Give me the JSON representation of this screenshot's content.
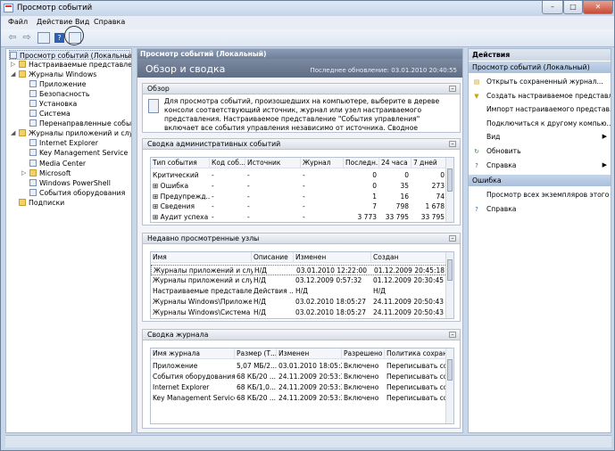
{
  "window": {
    "title": "Просмотр событий",
    "minimize": "–",
    "maximize": "□",
    "close": "✕"
  },
  "menu": [
    "Файл",
    "Действие",
    "Вид",
    "Справка"
  ],
  "toolbar": {
    "back": "⇦",
    "forward": "⇨"
  },
  "tree": {
    "root": "Просмотр событий (Локальный)",
    "items": [
      {
        "label": "Настраиваемые представлен",
        "indent": 1,
        "expander": "▷",
        "icon": "folder"
      },
      {
        "label": "Журналы Windows",
        "indent": 1,
        "expander": "◢",
        "icon": "folder"
      },
      {
        "label": "Приложение",
        "indent": 2,
        "icon": "log"
      },
      {
        "label": "Безопасность",
        "indent": 2,
        "icon": "log"
      },
      {
        "label": "Установка",
        "indent": 2,
        "icon": "log"
      },
      {
        "label": "Система",
        "indent": 2,
        "icon": "log"
      },
      {
        "label": "Перенаправленные события",
        "indent": 2,
        "icon": "log"
      },
      {
        "label": "Журналы приложений и служб",
        "indent": 1,
        "expander": "◢",
        "icon": "folder"
      },
      {
        "label": "Internet Explorer",
        "indent": 2,
        "icon": "log"
      },
      {
        "label": "Key Management Service",
        "indent": 2,
        "icon": "log"
      },
      {
        "label": "Media Center",
        "indent": 2,
        "icon": "log"
      },
      {
        "label": "Microsoft",
        "indent": 2,
        "expander": "▷",
        "icon": "folder"
      },
      {
        "label": "Windows PowerShell",
        "indent": 2,
        "icon": "log"
      },
      {
        "label": "События оборудования",
        "indent": 2,
        "icon": "log"
      },
      {
        "label": "Подписки",
        "indent": 1,
        "icon": "folder"
      }
    ]
  },
  "center": {
    "header": "Просмотр событий (Локальный)",
    "title": "Обзор и сводка",
    "updated": "Последнее обновление: 03.01.2010 20:40:55",
    "overview": {
      "title": "Обзор",
      "text": "Для просмотра событий, произошедших на компьютере, выберите в дереве консоли соответствующий источник, журнал или узел настраиваемого представления. Настраиваемое представление \"События управления\" включает все события управления независимо от источника. Сводное представление всех журналов"
    },
    "admin": {
      "title": "Сводка административных событий",
      "columns": [
        "Тип события",
        "Код соб...",
        "Источник",
        "Журнал",
        "Последн...",
        "24 часа",
        "7 дней"
      ],
      "rows": [
        [
          "Критический",
          "-",
          "-",
          "-",
          "0",
          "0",
          "0"
        ],
        [
          "⊞ Ошибка",
          "-",
          "-",
          "-",
          "0",
          "35",
          "273"
        ],
        [
          "⊞ Предупрежд...",
          "-",
          "-",
          "-",
          "1",
          "16",
          "74"
        ],
        [
          "⊞ Сведения",
          "-",
          "-",
          "-",
          "7",
          "798",
          "1 678"
        ],
        [
          "⊞ Аудит успеха",
          "-",
          "-",
          "-",
          "3 773",
          "33 795",
          "33 795"
        ]
      ]
    },
    "recent": {
      "title": "Недавно просмотренные узлы",
      "columns": [
        "Имя",
        "Описание",
        "Изменен",
        "Создан"
      ],
      "rows": [
        [
          "Журналы приложений и слу...",
          "Н/Д",
          "03.01.2010 12:22:00",
          "01.12.2009 20:45:18"
        ],
        [
          "Журналы приложений и слу...",
          "Н/Д",
          "03.12.2009 0:57:32",
          "01.12.2009 20:30:45"
        ],
        [
          "Настраиваемые представлен...",
          "Действия ...",
          "Н/Д",
          "Н/Д"
        ],
        [
          "Журналы Windows\\Приложе...",
          "Н/Д",
          "03.02.2010 18:05:27",
          "24.11.2009 20:50:43"
        ],
        [
          "Журналы Windows\\Система",
          "Н/Д",
          "03.02.2010 18:05:27",
          "24.11.2009 20:50:43"
        ]
      ]
    },
    "logsum": {
      "title": "Сводка журнала",
      "columns": [
        "Имя журнала",
        "Размер (Т...",
        "Изменен",
        "Разрешено",
        "Политика сохране"
      ],
      "rows": [
        [
          "Приложение",
          "5,07 МБ/2...",
          "03.01.2010 18:05:27",
          "Включено",
          "Переписывать со"
        ],
        [
          "События оборудования",
          "68 КБ/20 ...",
          "24.11.2009 20:53:33",
          "Включено",
          "Переписывать со"
        ],
        [
          "Internet Explorer",
          "68 КБ/1,0...",
          "24.11.2009 20:53:33",
          "Включено",
          "Переписывать со"
        ],
        [
          "Key Management Service",
          "68 КБ/20 ...",
          "24.11.2009 20:53:33",
          "Включено",
          "Переписывать со"
        ]
      ]
    }
  },
  "actions": {
    "title": "Действия",
    "group1": "Просмотр событий (Локальный)",
    "items1": [
      {
        "label": "Открыть сохраненный журнал...",
        "icon": "open-icon",
        "glyph": "▤",
        "color": "#d1a21e"
      },
      {
        "label": "Создать настраиваемое представл...",
        "icon": "filter-icon",
        "glyph": "▼",
        "color": "#c9a316"
      },
      {
        "label": "Импорт настраиваемого представ...",
        "icon": "import-icon",
        "glyph": "",
        "color": "#999"
      },
      {
        "label": "Подключиться к другому компью...",
        "icon": "connect-icon",
        "glyph": "",
        "color": "#999"
      },
      {
        "label": "Вид",
        "icon": "view-icon",
        "glyph": "",
        "color": "#999",
        "submenu": "▶"
      },
      {
        "label": "Обновить",
        "icon": "refresh-icon",
        "glyph": "↻",
        "color": "#2e8b3d"
      },
      {
        "label": "Справка",
        "icon": "help-icon",
        "glyph": "?",
        "color": "#2d5fb3",
        "submenu": "▶"
      }
    ],
    "group2": "Ошибка",
    "items2": [
      {
        "label": "Просмотр всех экземпляров этого ...",
        "icon": "instances-icon",
        "glyph": "",
        "color": "#999"
      },
      {
        "label": "Справка",
        "icon": "help-icon",
        "glyph": "?",
        "color": "#2d5fb3"
      }
    ]
  }
}
